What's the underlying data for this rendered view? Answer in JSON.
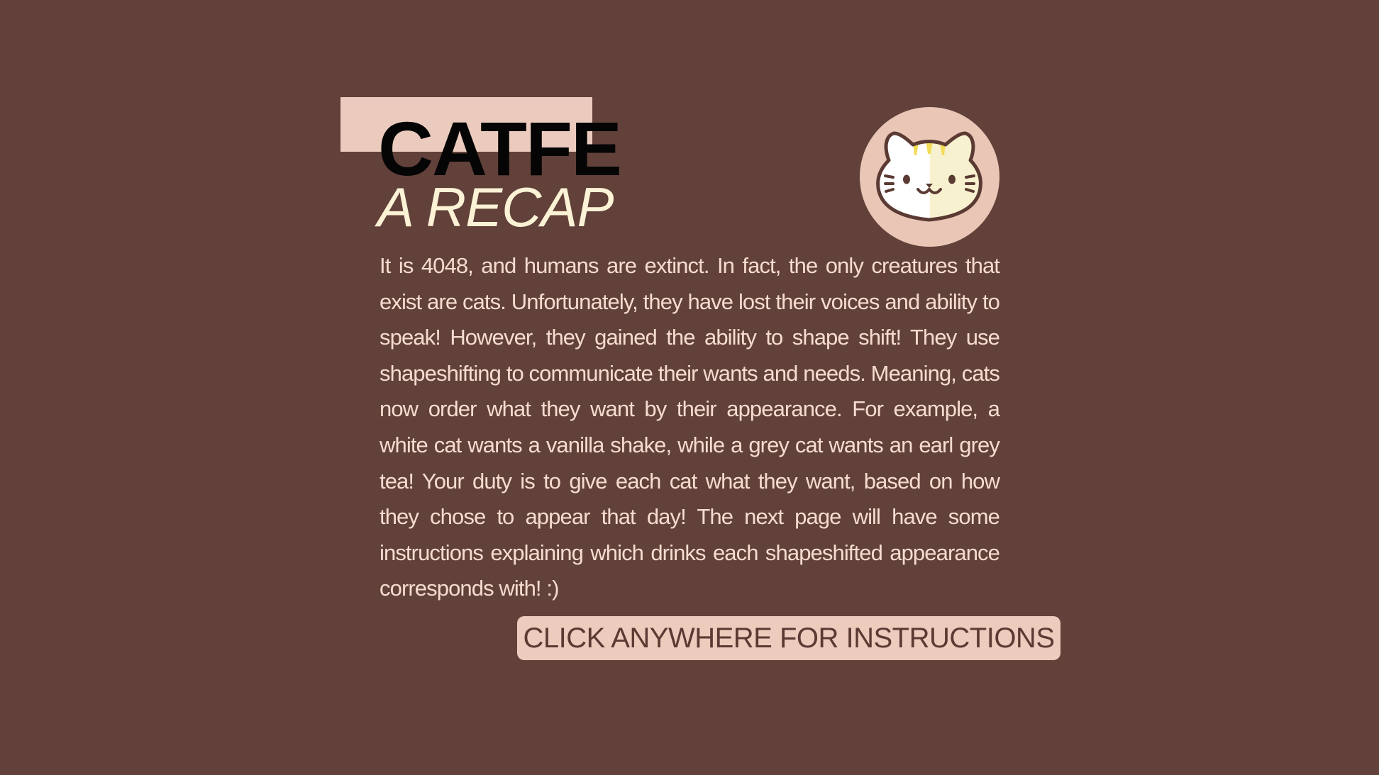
{
  "header": {
    "title": "CATFE",
    "subtitle": "A RECAP"
  },
  "logo": {
    "icon": "cat-face-icon"
  },
  "story": {
    "text": "It is 4048, and humans are extinct. In fact, the only creatures that exist are cats.  Unfortunately, they have lost their voices and ability to speak! However, they gained the ability to shape shift! They use shapeshifting to communicate their wants and needs. Meaning, cats now order what they want by their appearance. For example, a white cat wants a vanilla shake, while a grey cat wants an earl grey tea! Your duty is to give each cat what they want, based on how they chose to appear that day! The next page will have some instructions explaining which drinks each shapeshifted appearance corresponds with! :)"
  },
  "cta": {
    "label": "CLICK ANYWHERE FOR INSTRUCTIONS"
  },
  "colors": {
    "background": "#62413a",
    "accent_pink": "#ebcbbd",
    "title_dark": "#050505",
    "subtitle_cream": "#fcf2d6",
    "body_text": "#f6dcd0",
    "button_text": "#5a3a33"
  }
}
